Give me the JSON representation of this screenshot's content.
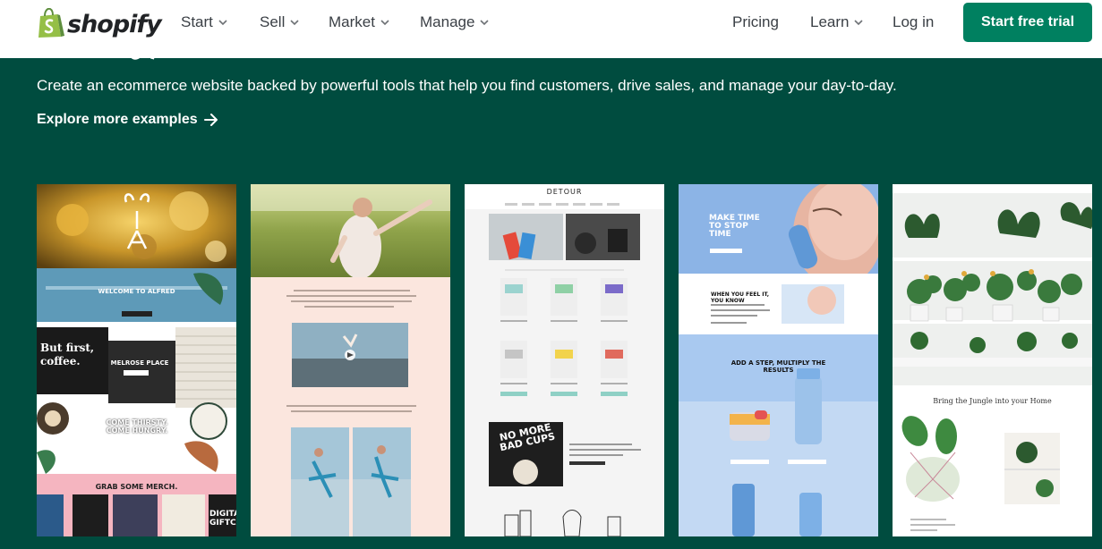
{
  "header": {
    "brand": "shopify",
    "nav": [
      {
        "label": "Start"
      },
      {
        "label": "Sell"
      },
      {
        "label": "Market"
      },
      {
        "label": "Manage"
      }
    ],
    "right": {
      "pricing": "Pricing",
      "learn": "Learn",
      "login": "Log in"
    },
    "cta": "Start free trial"
  },
  "hero": {
    "subtitle": "Create an ecommerce website backed by powerful tools that help you find customers, drive sales, and manage your day-to-day.",
    "explore": "Explore more examples"
  },
  "examples": [
    {
      "name": "alfred",
      "texts": {
        "welcome": "WELCOME TO ALFRED",
        "coffee": "But first, coffee.",
        "melrose": "MELROSE PLACE",
        "come": "COME THIRSTY. COME HUNGRY.",
        "merch": "GRAB SOME MERCH.",
        "digital": "DIGITA GIFTCA"
      }
    },
    {
      "name": "yoga",
      "texts": {}
    },
    {
      "name": "detour",
      "texts": {
        "brand": "DETOUR",
        "nomore": "NO MORE BAD CUPS"
      }
    },
    {
      "name": "skincare",
      "texts": {
        "hero": "MAKE TIME TO STOP TIME",
        "feel": "WHEN YOU FEEL IT, YOU KNOW",
        "step": "ADD A STEP, MULTIPLY THE RESULTS"
      }
    },
    {
      "name": "jungle",
      "texts": {
        "tagline": "Bring the Jungle into your Home"
      }
    }
  ],
  "colors": {
    "brand_green": "#008060",
    "hero_bg": "#004c3f"
  }
}
